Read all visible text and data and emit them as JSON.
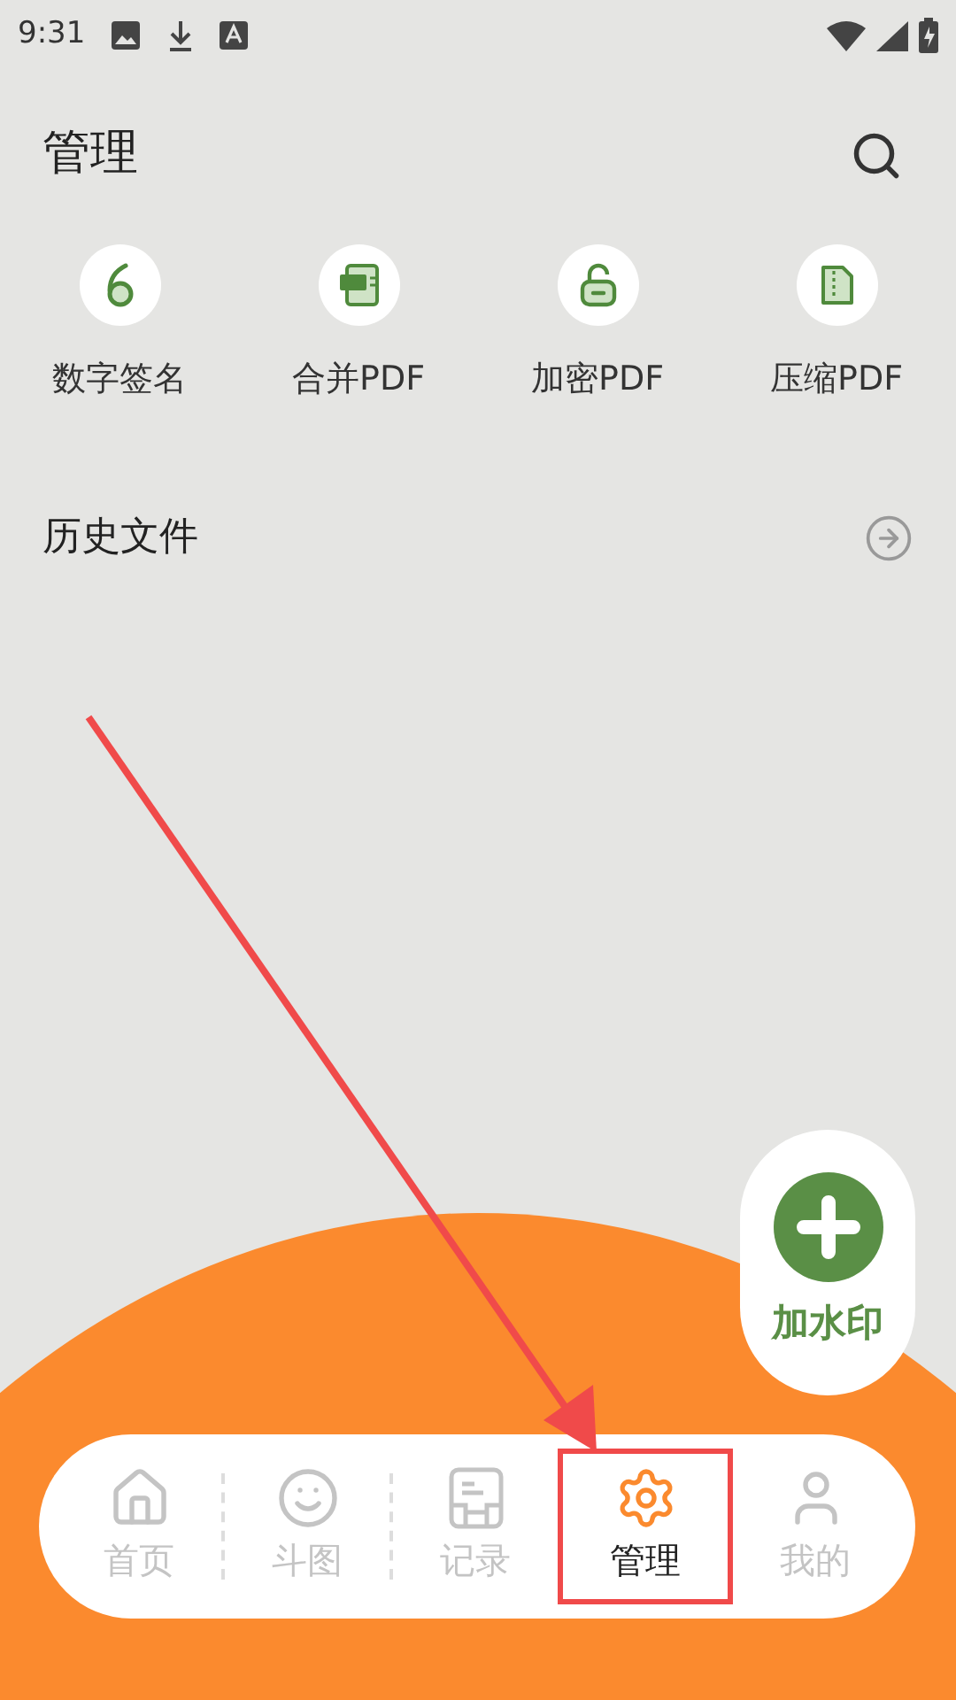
{
  "status_bar": {
    "time": "9:31"
  },
  "header": {
    "title": "管理"
  },
  "tools": [
    {
      "label": "数字签名",
      "kind": "signature"
    },
    {
      "label": "合并PDF",
      "kind": "merge"
    },
    {
      "label": "加密PDF",
      "kind": "encrypt"
    },
    {
      "label": "压缩PDF",
      "kind": "compress"
    }
  ],
  "history": {
    "label": "历史文件"
  },
  "fab": {
    "label": "加水印"
  },
  "nav": [
    {
      "label": "首页",
      "kind": "home",
      "selected": false
    },
    {
      "label": "斗图",
      "kind": "smile",
      "selected": false
    },
    {
      "label": "记录",
      "kind": "record",
      "selected": false
    },
    {
      "label": "管理",
      "kind": "settings",
      "selected": true
    },
    {
      "label": "我的",
      "kind": "user",
      "selected": false
    }
  ]
}
